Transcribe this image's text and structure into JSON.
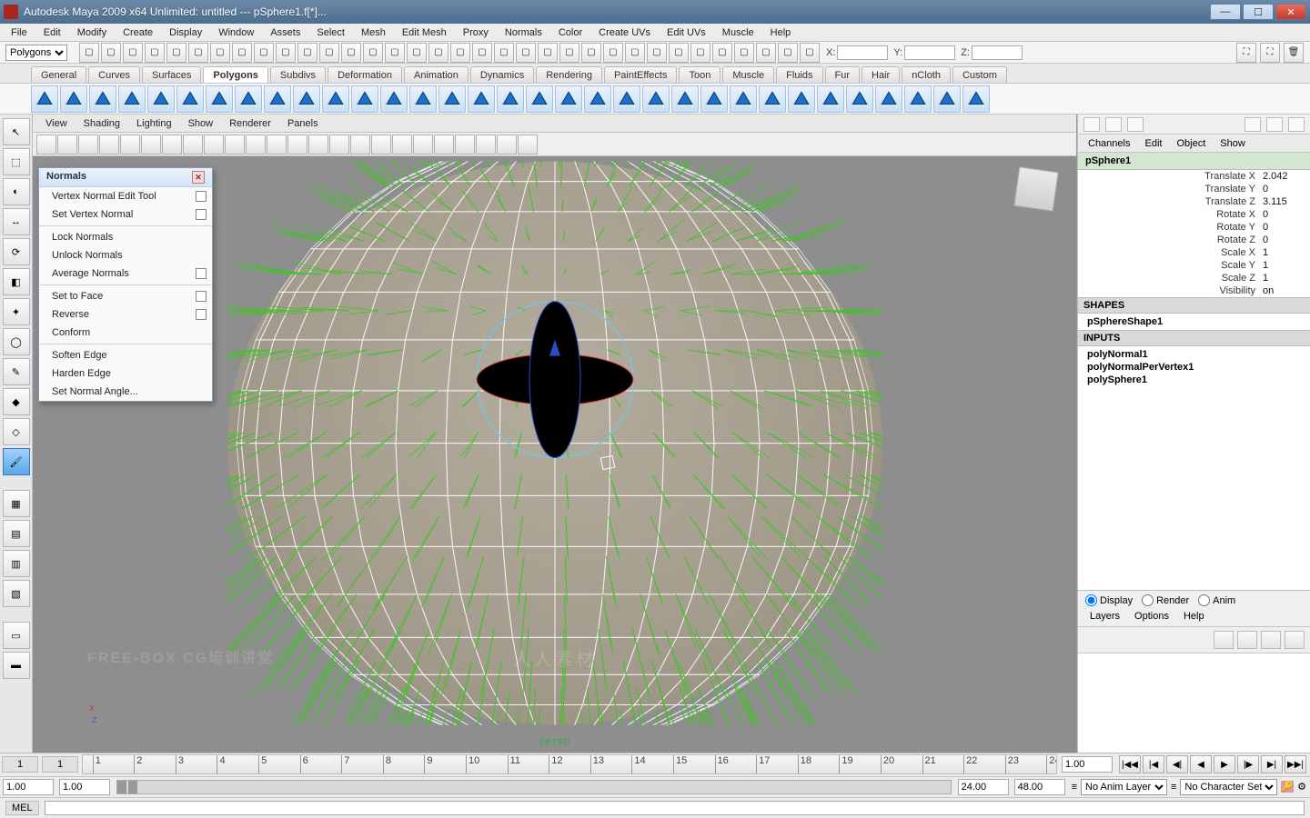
{
  "title": "Autodesk Maya 2009 x64 Unlimited: untitled   ---   pSphere1.f[*]...",
  "menubar": [
    "File",
    "Edit",
    "Modify",
    "Create",
    "Display",
    "Window",
    "Assets",
    "Select",
    "Mesh",
    "Edit Mesh",
    "Proxy",
    "Normals",
    "Color",
    "Create UVs",
    "Edit UVs",
    "Muscle",
    "Help"
  ],
  "mode_selector": "Polygons",
  "coords": {
    "xlabel": "X:",
    "ylabel": "Y:",
    "zlabel": "Z:",
    "x": "",
    "y": "",
    "z": ""
  },
  "shelf_tabs": [
    "General",
    "Curves",
    "Surfaces",
    "Polygons",
    "Subdivs",
    "Deformation",
    "Animation",
    "Dynamics",
    "Rendering",
    "PaintEffects",
    "Toon",
    "Muscle",
    "Fluids",
    "Fur",
    "Hair",
    "nCloth",
    "Custom"
  ],
  "shelf_active": "Polygons",
  "panel_menu": [
    "View",
    "Shading",
    "Lighting",
    "Show",
    "Renderer",
    "Panels"
  ],
  "persp_label": "persp",
  "channel": {
    "menu": [
      "Channels",
      "Edit",
      "Object",
      "Show"
    ],
    "object": "pSphere1",
    "attrs": [
      {
        "k": "Translate X",
        "v": "2.042"
      },
      {
        "k": "Translate Y",
        "v": "0"
      },
      {
        "k": "Translate Z",
        "v": "3.115"
      },
      {
        "k": "Rotate X",
        "v": "0"
      },
      {
        "k": "Rotate Y",
        "v": "0"
      },
      {
        "k": "Rotate Z",
        "v": "0"
      },
      {
        "k": "Scale X",
        "v": "1"
      },
      {
        "k": "Scale Y",
        "v": "1"
      },
      {
        "k": "Scale Z",
        "v": "1"
      },
      {
        "k": "Visibility",
        "v": "on"
      }
    ],
    "shapes_h": "SHAPES",
    "shape": "pSphereShape1",
    "inputs_h": "INPUTS",
    "inputs": [
      "polyNormal1",
      "polyNormalPerVertex1",
      "polySphere1"
    ]
  },
  "layerbox": {
    "radios": [
      "Display",
      "Render",
      "Anim"
    ],
    "menu": [
      "Layers",
      "Options",
      "Help"
    ]
  },
  "popup": {
    "title": "Normals",
    "groups": [
      [
        {
          "t": "Vertex Normal Edit Tool",
          "o": true
        },
        {
          "t": "Set Vertex Normal",
          "o": true
        }
      ],
      [
        {
          "t": "Lock Normals"
        },
        {
          "t": "Unlock Normals"
        },
        {
          "t": "Average Normals",
          "o": true
        }
      ],
      [
        {
          "t": "Set to Face",
          "o": true
        },
        {
          "t": "Reverse",
          "o": true
        },
        {
          "t": "Conform"
        }
      ],
      [
        {
          "t": "Soften Edge"
        },
        {
          "t": "Harden Edge"
        },
        {
          "t": "Set Normal Angle..."
        }
      ]
    ]
  },
  "time": {
    "start_disp": "1",
    "end_disp": "1",
    "cur": "1.00",
    "range_start": "1.00",
    "range_end_vis": "1.00",
    "range_min": "24.00",
    "range_max": "48.00",
    "ticks": [
      1,
      2,
      3,
      4,
      5,
      6,
      7,
      8,
      9,
      10,
      11,
      12,
      13,
      14,
      15,
      16,
      17,
      18,
      19,
      20,
      21,
      22,
      23,
      24
    ],
    "anim_layer": "No Anim Layer",
    "char_set": "No Character Set"
  },
  "cmd_label": "MEL",
  "watermark": "人人素材",
  "watermark2": "FREE-BOX  CG培训讲堂"
}
